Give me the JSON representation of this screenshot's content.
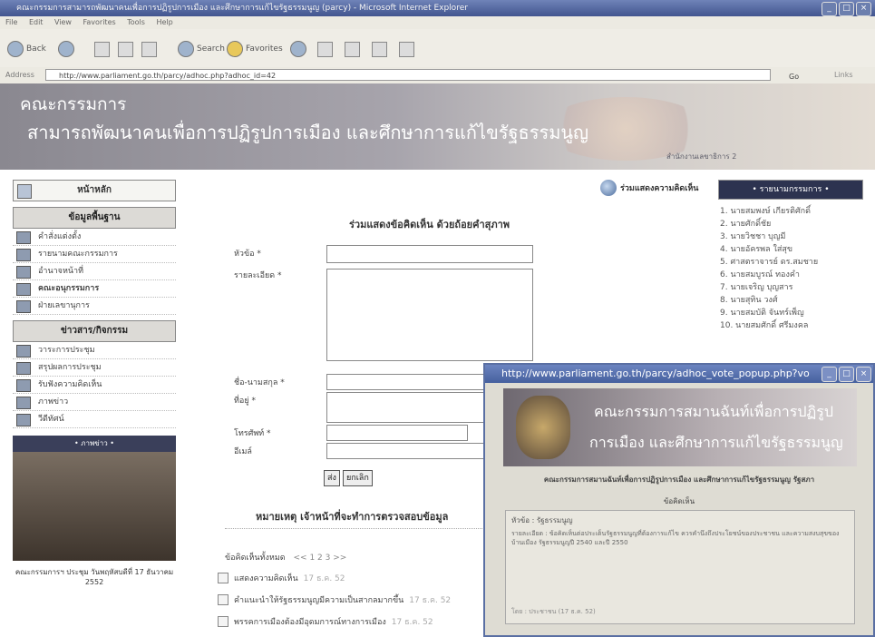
{
  "window": {
    "title": "คณะกรรมการสามารถพัฒนาคนเพื่อการปฏิรูปการเมือง และศึกษาการแก้ไขรัฐธรรมนูญ (parcy) - Microsoft Internet Explorer",
    "min": "_",
    "max": "□",
    "close": "×"
  },
  "menu": [
    "File",
    "Edit",
    "View",
    "Favorites",
    "Tools",
    "Help"
  ],
  "toolbar": {
    "back": "Back",
    "search": "Search",
    "favorites": "Favorites"
  },
  "address": {
    "label": "Address",
    "url": "http://www.parliament.go.th/parcy/adhoc.php?adhoc_id=42",
    "go": "Go",
    "links": "Links"
  },
  "banner": {
    "line1": "คณะกรรมการ",
    "line2": "สามารถพัฒนาคนเพื่อการปฏิรูปการเมือง และศึกษาการแก้ไขรัฐธรรมนูญ",
    "line3": "สำนักงานเลขาธิการ 2"
  },
  "sidebar": {
    "home": "หน้าหลัก",
    "section1": "ข้อมูลพื้นฐาน",
    "items1": [
      "คำสั่งแต่งตั้ง",
      "รายนามคณะกรรมการ",
      "อำนาจหน้าที่",
      "คณะอนุกรรมการ",
      "ฝ่ายเลขานุการ"
    ],
    "section2": "ข่าวสาร/กิจกรรม",
    "items2": [
      "วาระการประชุม",
      "สรุปผลการประชุม",
      "รับฟังความคิดเห็น",
      "ภาพข่าว",
      "วีดีทัศน์"
    ],
    "photo_head": "• ภาพข่าว •",
    "photo_caption": "คณะกรรมการฯ ประชุม วันพฤหัสบดีที่ 17 ธันวาคม 2552"
  },
  "content": {
    "join_link": "ร่วมแสดงความคิดเห็น",
    "form_title": "ร่วมแสดงข้อคิดเห็น ด้วยถ้อยคำสุภาพ",
    "labels": {
      "subject": "หัวข้อ *",
      "details": "รายละเอียด *",
      "name": "ชื่อ-นามสกุล *",
      "address": "ที่อยู่ *",
      "phone": "โทรศัพท์ *",
      "email": "อีเมล์"
    },
    "submit": "ส่ง",
    "cancel": "ยกเลิก",
    "note": "หมายเหตุ เจ้าหน้าที่จะทำการตรวจสอบข้อมูล",
    "count_label": "ข้อคิดเห็นทั้งหมด",
    "pages": "<< 1 2 3 >>",
    "recent": [
      {
        "title": "แสดงความคิดเห็น",
        "date": "17 ธ.ค. 52"
      },
      {
        "title": "คำแนะนำให้รัฐธรรมนูญมีความเป็นสากลมากขึ้น",
        "date": "17 ธ.ค. 52"
      },
      {
        "title": "พรรคการเมืองต้องมีอุดมการณ์ทางการเมือง",
        "date": "17 ธ.ค. 52"
      }
    ]
  },
  "right": {
    "header": "• รายนามกรรมการ •",
    "members": [
      "1. นายสมพงษ์ เกียรติศักดิ์",
      "2. นายศักดิ์ชัย",
      "3. นายวิชชา บุญมี",
      "4. นายอัครพล ใส่สุข",
      "5. ศาสตราจารย์ ดร.สมชาย",
      "6. นายสมบูรณ์ ทองคำ",
      "7. นายเจริญ บุญสาร",
      "8. นายสุทิน วงศ์",
      "9. นายสมบัติ จันทร์เพ็ญ",
      "10. นายสมศักดิ์ ศรีมงคล"
    ]
  },
  "popup": {
    "title": "http://www.parliament.go.th/parcy/adhoc_vote_popup.php?vo",
    "min": "_",
    "max": "□",
    "close": "×",
    "banner1": "คณะกรรมการสมานฉันท์เพื่อการปฏิรูป",
    "banner2": "การเมือง และศึกษาการแก้ไขรัฐธรรมนูญ",
    "subtitle": "คณะกรรมการสมานฉันท์เพื่อการปฏิรูปการเมือง และศึกษาการแก้ไขรัฐธรรมนูญ รัฐสภา",
    "heading": "ข้อคิดเห็น",
    "topic": "หัวข้อ : รัฐธรรมนูญ",
    "details": "รายละเอียด : ข้อคิดเห็นต่อประเด็นรัฐธรรมนูญที่ต้องการแก้ไข ควรคำนึงถึงประโยชน์ของประชาชน และความสงบสุขของบ้านเมือง รัฐธรรมนูญปี 2540 และปี 2550",
    "footer": "โดย : ประชาชน (17 ธ.ค. 52)"
  }
}
